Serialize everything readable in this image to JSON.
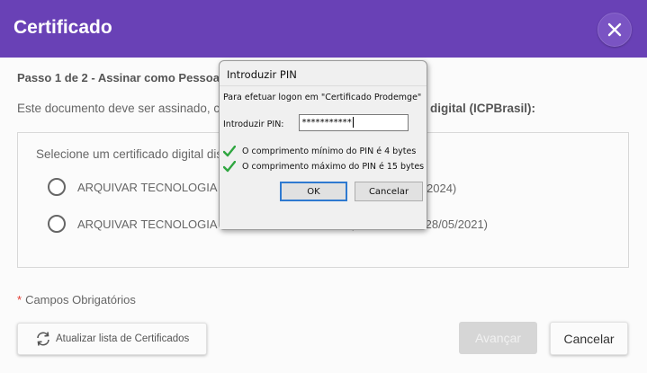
{
  "header": {
    "title": "Certificado",
    "close_icon": "close-icon"
  },
  "main": {
    "step": "Passo 1 de 2 - Assinar como Pessoa Fís",
    "description_left": "Este documento deve ser assinado, co",
    "description_right": "digital (ICPBrasil):",
    "cert_prompt": "Selecione um certificado digital dis",
    "certificates": [
      {
        "label": "ARQUIVAR TECNOLOGIA LTDA",
        "tail": "2024)"
      },
      {
        "label": "ARQUIVAR TECNOLOGIA LTDA:15312870000173: (29/05/2018 a 28/05/2021)"
      }
    ],
    "required_note": "Campos Obrigatórios",
    "required_star": "*",
    "refresh_button": "Atualizar lista de Certificados",
    "next_button": "Avançar",
    "cancel_button": "Cancelar"
  },
  "pin_dialog": {
    "title": "Introduzir PIN",
    "message": "Para efetuar logon em \"Certificado Prodemge\"",
    "pin_label": "Introduzir PIN:",
    "pin_value": "***********",
    "rules": [
      "O comprimento mínimo do PIN é 4 bytes",
      "O comprimento máximo do PIN é 15 bytes"
    ],
    "ok_button": "OK",
    "cancel_button": "Cancelar"
  },
  "colors": {
    "header_bg": "#6941b6",
    "required_star": "#e2382f",
    "check_green": "#2fa640",
    "focus_blue": "#2f7ad0"
  }
}
